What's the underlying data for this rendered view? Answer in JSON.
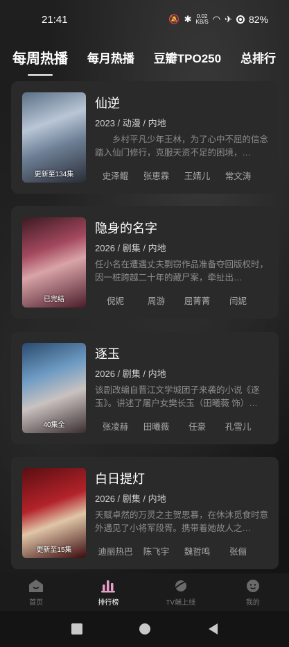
{
  "status_bar": {
    "time": "21:41",
    "speed_value": "0.02",
    "speed_unit": "KB/S",
    "battery": "82%"
  },
  "tabs": [
    {
      "label": "每周热播",
      "active": true
    },
    {
      "label": "每月热播",
      "active": false
    },
    {
      "label": "豆瓣TPO250",
      "active": false
    },
    {
      "label": "总排行",
      "active": false
    }
  ],
  "items": [
    {
      "title": "仙逆",
      "meta": "2023 / 动漫 / 内地",
      "desc": "　　乡村平凡少年王林，为了心中不屈的信念踏入仙门修行，克服天资不足的困境，…",
      "badge": "更新至134集",
      "cast": [
        "史泽鲲",
        "张恵霖",
        "王婧儿",
        "常文涛"
      ]
    },
    {
      "title": "隐身的名字",
      "meta": "2026 / 剧集 / 内地",
      "desc": "任小名在遭遇丈夫剽窃作品准备夺回版权时，因一桩跨越二十年的藏尸案，牵扯出…",
      "badge": "已完结",
      "cast": [
        "倪妮",
        "周游",
        "屈菁菁",
        "闫妮"
      ]
    },
    {
      "title": "逐玉",
      "meta": "2026 / 剧集 / 内地",
      "desc": "该剧改编自晋江文学城团子来袭的小说《逐玉》。讲述了屠户女樊长玉（田曦薇 饰）…",
      "badge": "40集全",
      "cast": [
        "张凌赫",
        "田曦薇",
        "任豪",
        "孔雪儿"
      ]
    },
    {
      "title": "白日提灯",
      "meta": "2026 / 剧集 / 内地",
      "desc": "天赋卓然的万灵之主贺思慕，在休沐觅食时意外遇见了小将军段胥。携带着她故人之…",
      "badge": "更新至15集",
      "cast": [
        "迪丽热巴",
        "陈飞宇",
        "魏哲鸣",
        "张俪"
      ]
    }
  ],
  "nav": [
    {
      "label": "首页",
      "icon": "home-icon",
      "active": false
    },
    {
      "label": "排行榜",
      "icon": "ranking-icon",
      "active": true
    },
    {
      "label": "TV端上线",
      "icon": "planet-icon",
      "active": false
    },
    {
      "label": "我的",
      "icon": "profile-icon",
      "active": false
    }
  ],
  "colors": {
    "accent": "#e8a0c8",
    "card_bg": "#2a2a2a",
    "nav_bg": "#1b1b1b"
  }
}
